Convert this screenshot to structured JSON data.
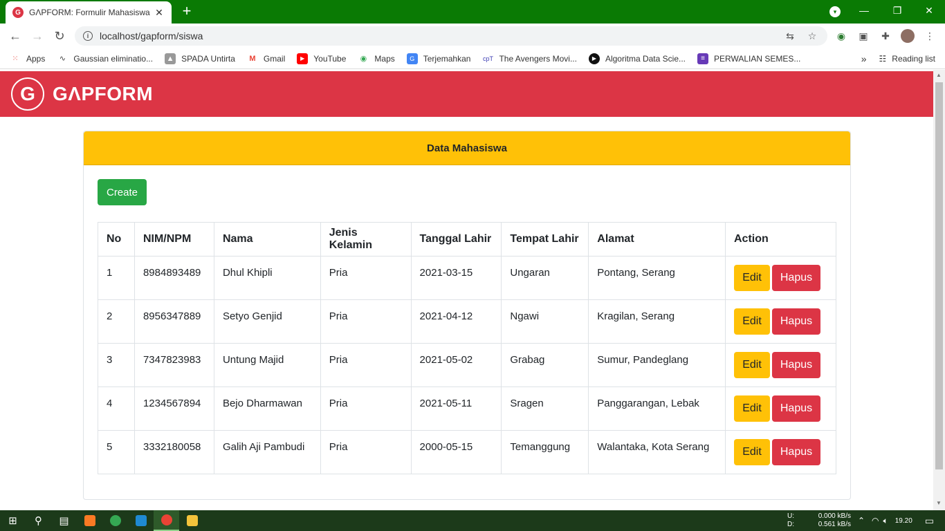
{
  "browser": {
    "tab_favicon": "G",
    "tab_title": "GΛPFORM: Formulir Mahasiswa",
    "tab_close": "✕",
    "new_tab": "+",
    "url": "localhost/gapform/siswa",
    "minimize": "—",
    "restore": "❐",
    "close": "✕",
    "bookmarks": [
      {
        "label": "Apps",
        "icon": "apps-grid-icon",
        "color": "#e8453c"
      },
      {
        "label": "Gaussian eliminatio...",
        "icon": "gaussian-icon",
        "color": "#444444"
      },
      {
        "label": "SPADA Untirta",
        "icon": "spada-icon",
        "color": "#777777"
      },
      {
        "label": "Gmail",
        "icon": "gmail-icon",
        "color": "#ea4335"
      },
      {
        "label": "YouTube",
        "icon": "youtube-icon",
        "color": "#ff0000"
      },
      {
        "label": "Maps",
        "icon": "maps-icon",
        "color": "#34a853"
      },
      {
        "label": "Terjemahkan",
        "icon": "translate-icon",
        "color": "#4285f4"
      },
      {
        "label": "The Avengers Movi...",
        "icon": "cpt-icon",
        "color": "#3b3bb3"
      },
      {
        "label": "Algoritma Data Scie...",
        "icon": "algoritma-icon",
        "color": "#111111"
      },
      {
        "label": "PERWALIAN SEMES...",
        "icon": "forms-icon",
        "color": "#673ab7"
      }
    ],
    "more_bookmarks": "»",
    "reading_list": "Reading list"
  },
  "app": {
    "logo_letter": "G",
    "logo_text": "GΛPFORM",
    "brand_color": "#dc3545"
  },
  "card": {
    "title": "Data Mahasiswa",
    "create_label": "Create"
  },
  "table": {
    "headers": [
      "No",
      "NIM/NPM",
      "Nama",
      "Jenis Kelamin",
      "Tanggal Lahir",
      "Tempat Lahir",
      "Alamat",
      "Action"
    ],
    "rows": [
      {
        "no": "1",
        "nim": "8984893489",
        "nama": "Dhul Khipli",
        "jk": "Pria",
        "tgl": "2021-03-15",
        "tempat": "Ungaran",
        "alamat": "Pontang, Serang"
      },
      {
        "no": "2",
        "nim": "8956347889",
        "nama": "Setyo Genjid",
        "jk": "Pria",
        "tgl": "2021-04-12",
        "tempat": "Ngawi",
        "alamat": "Kragilan, Serang"
      },
      {
        "no": "3",
        "nim": "7347823983",
        "nama": "Untung Majid",
        "jk": "Pria",
        "tgl": "2021-05-02",
        "tempat": "Grabag",
        "alamat": "Sumur, Pandeglang"
      },
      {
        "no": "4",
        "nim": "1234567894",
        "nama": "Bejo Dharmawan",
        "jk": "Pria",
        "tgl": "2021-05-11",
        "tempat": "Sragen",
        "alamat": "Panggarangan, Lebak"
      },
      {
        "no": "5",
        "nim": "3332180058",
        "nama": "Galih Aji Pambudi",
        "jk": "Pria",
        "tgl": "2000-05-15",
        "tempat": "Temanggung",
        "alamat": "Walantaka, Kota Serang"
      }
    ],
    "edit_label": "Edit",
    "delete_label": "Hapus"
  },
  "taskbar": {
    "upload_label": "U:",
    "download_label": "D:",
    "upload_rate": "0.000 kB/s",
    "download_rate": "0.561 kB/s",
    "time": "19.20"
  }
}
